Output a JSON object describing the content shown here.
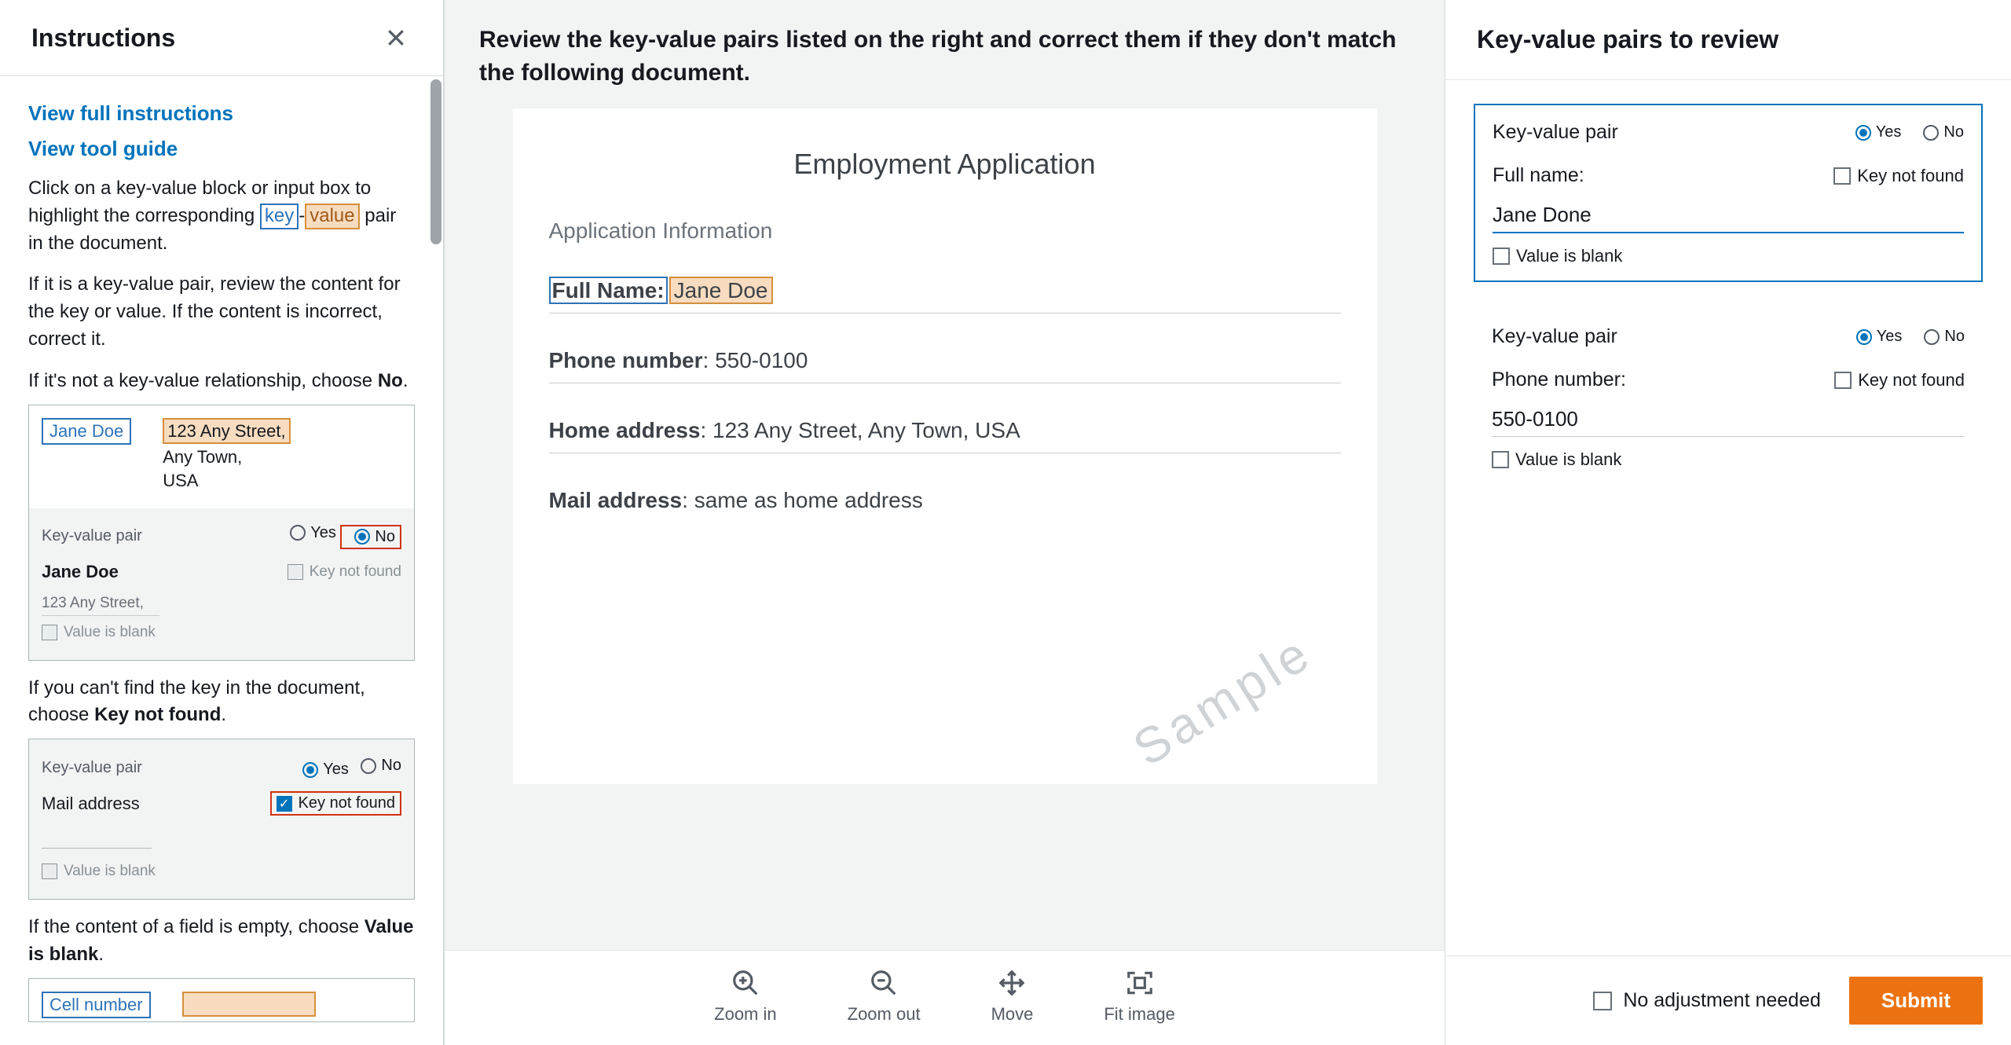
{
  "instructions": {
    "title": "Instructions",
    "link_full": "View full instructions",
    "link_guide": "View tool guide",
    "para1_pre": "Click on a key-value block or input box to highlight the corresponding ",
    "key_word": "key",
    "value_word": "value",
    "para1_post": " pair in the document.",
    "para2": "If it is a key-value pair, review the content for the key or value. If the content is incorrect, correct it.",
    "para3_pre": "If it's not a key-value relationship, choose ",
    "para3_bold": "No",
    "example1": {
      "chip_key": "Jane Doe",
      "chip_val_line1": "123 Any Street,",
      "chip_val_line2": "Any Town,",
      "chip_val_line3": "USA",
      "kvp_label": "Key-value pair",
      "yes": "Yes",
      "no": "No",
      "key_display": "Jane Doe",
      "knf_label": "Key not found",
      "value_display": "123 Any Street,",
      "vb_label": "Value is blank"
    },
    "para4_pre": "If you can't find the key in the document, choose ",
    "para4_bold": "Key not found",
    "example2": {
      "kvp_label": "Key-value pair",
      "yes": "Yes",
      "no": "No",
      "key_display": "Mail address",
      "knf_label": "Key not found",
      "vb_label": "Value is blank"
    },
    "para5_pre": "If the content of a field is empty, choose ",
    "para5_bold": "Value is blank",
    "example3": {
      "chip_key": "Cell number"
    }
  },
  "center": {
    "prompt": "Review the key-value pairs listed on the right and correct them if they don't match the following document.",
    "doc": {
      "title": "Employment Application",
      "section": "Application Information",
      "full_name_key": "Full Name:",
      "full_name_val": "Jane Doe",
      "phone_key": "Phone number",
      "phone_val": "550-0100",
      "home_key": "Home address",
      "home_val": "123 Any Street, Any Town, USA",
      "mail_key": "Mail address",
      "mail_val": "same as home address",
      "watermark": "Sample"
    },
    "tools": {
      "zoom_in": "Zoom in",
      "zoom_out": "Zoom out",
      "move": "Move",
      "fit": "Fit image"
    }
  },
  "review": {
    "title": "Key-value pairs to review",
    "kvp_label": "Key-value pair",
    "yes": "Yes",
    "no": "No",
    "knf_label": "Key not found",
    "vb_label": "Value is blank",
    "pairs": [
      {
        "key": "Full name:",
        "value": "Jane Done",
        "active": true
      },
      {
        "key": "Phone number:",
        "value": "550-0100",
        "active": false
      }
    ],
    "no_adjust": "No adjustment needed",
    "submit": "Submit"
  }
}
